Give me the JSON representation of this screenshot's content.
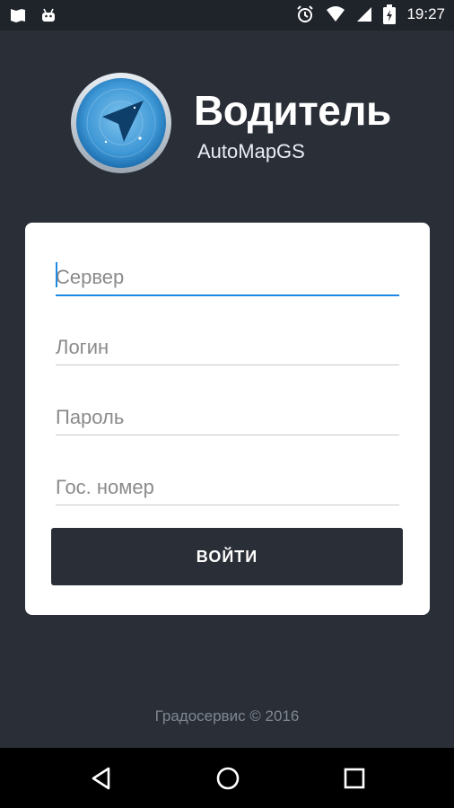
{
  "status_bar": {
    "time": "19:27",
    "left_icons": [
      "image-icon",
      "android-icon"
    ],
    "right_icons": [
      "alarm-icon",
      "wifi-icon",
      "signal-icon",
      "battery-icon"
    ]
  },
  "brand": {
    "title": "Водитель",
    "subtitle": "AutoMapGS"
  },
  "form": {
    "server": {
      "placeholder": "Сервер",
      "value": ""
    },
    "login": {
      "placeholder": "Логин",
      "value": ""
    },
    "password": {
      "placeholder": "Пароль",
      "value": ""
    },
    "plate": {
      "placeholder": "Гос. номер",
      "value": ""
    },
    "submit_label": "ВОЙТИ"
  },
  "footer": {
    "copyright": "Градосервис © 2016"
  },
  "colors": {
    "background": "#2a2f37",
    "accent": "#1e88e5",
    "card": "#ffffff"
  }
}
